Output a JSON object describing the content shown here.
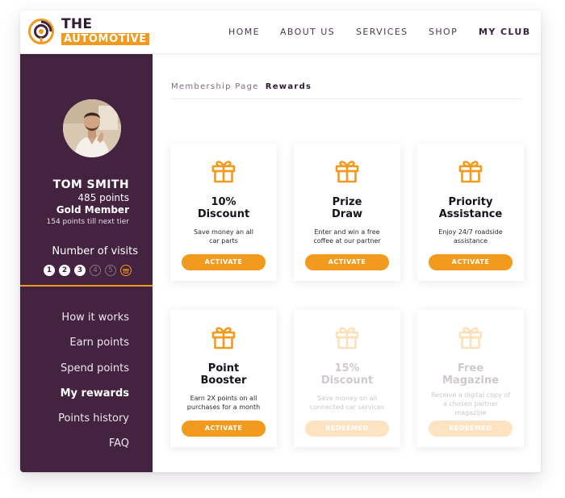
{
  "brand": {
    "name_line1": "THE",
    "name_line2": "AUTOMOTIVE",
    "accent_color": "#f29a1d",
    "dark_color": "#43233f"
  },
  "nav": {
    "items": [
      "HOME",
      "ABOUT US",
      "SERVICES",
      "SHOP",
      "MY CLUB"
    ],
    "active": "MY CLUB"
  },
  "profile": {
    "name": "TOM SMITH",
    "points": "485  points",
    "tier": "Gold Member",
    "next_tier": "154 points till next tier"
  },
  "visits": {
    "label": "Number of visits",
    "steps": [
      "1",
      "2",
      "3",
      "4",
      "5"
    ],
    "completed": 3,
    "reward_icon": "gift-icon"
  },
  "sidebar_menu": {
    "items": [
      "How it works",
      "Earn points",
      "Spend points",
      "My rewards",
      "Points history",
      "FAQ"
    ],
    "active": "My rewards"
  },
  "breadcrumb": {
    "parent": "Membership Page",
    "current": "Rewards"
  },
  "rewards": [
    {
      "title_line1": "10%",
      "title_line2": "Discount",
      "desc_line1": "Save money an all",
      "desc_line2": "car parts",
      "desc_line3": "",
      "button": "ACTIVATE",
      "state": "active"
    },
    {
      "title_line1": "Prize",
      "title_line2": "Draw",
      "desc_line1": "Enter and win a free",
      "desc_line2": "coffee at our partner",
      "desc_line3": "",
      "button": "ACTIVATE",
      "state": "active"
    },
    {
      "title_line1": "Priority",
      "title_line2": "Assistance",
      "desc_line1": "Enjoy 24/7 roadside",
      "desc_line2": "assistance",
      "desc_line3": "",
      "button": "ACTIVATE",
      "state": "active"
    },
    {
      "title_line1": "Point",
      "title_line2": "Booster",
      "desc_line1": "Earn 2X points on all",
      "desc_line2": "purchases for a month",
      "desc_line3": "",
      "button": "ACTIVATE",
      "state": "active"
    },
    {
      "title_line1": "15%",
      "title_line2": "Discount",
      "desc_line1": "Save money on all",
      "desc_line2": "connected car services",
      "desc_line3": "",
      "button": "REDEEMED",
      "state": "redeemed"
    },
    {
      "title_line1": "Free",
      "title_line2": "Magazine",
      "desc_line1": "Receive a digital copy of",
      "desc_line2": "a chosen partner",
      "desc_line3": "magazine",
      "button": "REDEEMED",
      "state": "redeemed"
    }
  ]
}
